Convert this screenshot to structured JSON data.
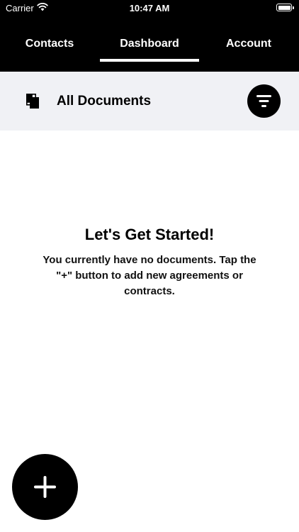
{
  "status_bar": {
    "carrier": "Carrier",
    "time": "10:47 AM"
  },
  "tabs": [
    {
      "label": "Contacts",
      "active": false
    },
    {
      "label": "Dashboard",
      "active": true
    },
    {
      "label": "Account",
      "active": false
    }
  ],
  "documents_header": {
    "title": "All Documents",
    "icon": "documents-icon",
    "filter_icon": "filter-icon"
  },
  "empty_state": {
    "title": "Let's Get Started!",
    "message": "You currently have no documents. Tap the \"+\" button to add new agreements or contracts."
  },
  "fab": {
    "icon": "plus-icon"
  },
  "colors": {
    "header_bg": "#000000",
    "subheader_bg": "#f0f1f5",
    "text": "#000000",
    "accent": "#000000"
  }
}
